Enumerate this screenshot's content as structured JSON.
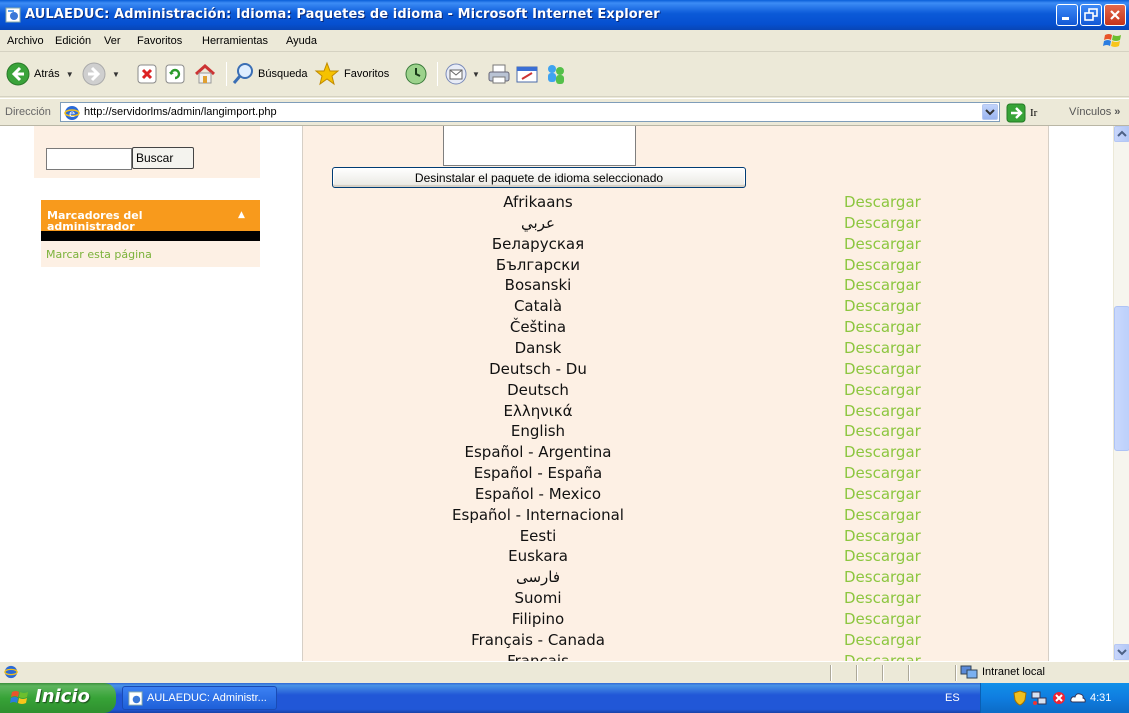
{
  "window": {
    "title": "AULAEDUC: Administración: Idioma: Paquetes de idioma - Microsoft Internet Explorer"
  },
  "menu": {
    "items": [
      "Archivo",
      "Edición",
      "Ver",
      "Favoritos",
      "Herramientas",
      "Ayuda"
    ]
  },
  "toolbar": {
    "back_label": "Atrás",
    "search_label": "Búsqueda",
    "favorites_label": "Favoritos"
  },
  "address": {
    "label": "Dirección",
    "url": "http://servidorlms/admin/langimport.php",
    "go_label": "Ir",
    "links_label": "Vínculos"
  },
  "sidebar": {
    "search_button": "Buscar",
    "search_value": "",
    "bookmarks_title": "Marcadores del administrador",
    "bookmark_link": "Marcar esta página"
  },
  "main": {
    "uninstall_button": "Desinstalar el paquete de idioma seleccionado",
    "download_label": "Descargar",
    "languages": [
      "Afrikaans",
      "عربي",
      "Беларуская",
      "Български",
      "Bosanski",
      "Català",
      "Čeština",
      "Dansk",
      "Deutsch - Du",
      "Deutsch",
      "Ελληνικά",
      "English",
      "Español - Argentina",
      "Español - España",
      "Español - Mexico",
      "Español - Internacional",
      "Eesti",
      "Euskara",
      "فارسی",
      "Suomi",
      "Filipino",
      "Français - Canada",
      "Français"
    ]
  },
  "status": {
    "zone": "Intranet local"
  },
  "taskbar": {
    "start_label": "Inicio",
    "task_label": "AULAEDUC: Administr...",
    "lang_indicator": "ES",
    "clock": "4:31"
  }
}
